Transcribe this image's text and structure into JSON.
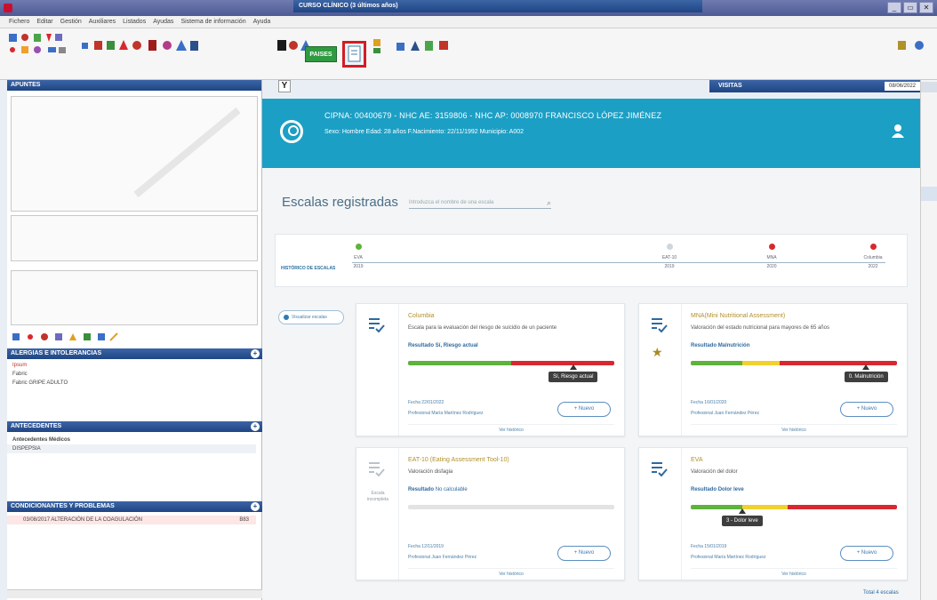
{
  "window": {
    "title": "",
    "controls": [
      "_",
      "▭",
      "✕"
    ]
  },
  "menu": [
    "Fichero",
    "Editar",
    "Gestión",
    "Auxiliares",
    "Listados",
    "Ayudas",
    "Sistema de información",
    "Ayuda"
  ],
  "toolbar": {
    "paises_label": "PAISES"
  },
  "left": {
    "apuntes_header": "APUNTES",
    "alergias_header": "ALERGIAS E INTOLERANCIAS",
    "alergias_rows": [
      "Ipsum",
      "Fabric",
      "Fabric   GRIPE ADULTO"
    ],
    "antecedentes_header": "ANTECEDENTES",
    "antecedentes_sub": "Antecedentes Médicos",
    "antecedentes_item": "DISPEPSIA",
    "condicionantes_header": "CONDICIONANTES Y PROBLEMAS",
    "condicionantes_item": "03/08/2017 ALTERACIÓN DE LA COAGULACIÓN",
    "condicionantes_code": "B83"
  },
  "center": {
    "header": "CURSO CLÍNICO (3 últimos años)",
    "visitas": "VISITAS",
    "visitas_date": "08/06/2022",
    "patient": {
      "line1": "CIPNA: 00400679   -   NHC AE: 3159806   -   NHC AP: 0008970      FRANCISCO LÓPEZ JIMÉNEZ",
      "line2": "Sexo: Hombre  Edad: 28 años  F.Nacimiento: 22/11/1992  Municipio: A002"
    },
    "escalas_title": "Escalas registradas",
    "search_placeholder": "Introduzca el nombre de una escala",
    "timeline": {
      "label": "HISTÓRICO DE ESCALAS",
      "points": [
        {
          "name": "EVA",
          "date": "2019",
          "color": "#5fb23c"
        },
        {
          "name": "EAT-10",
          "date": "2019",
          "color": "#cfd6dc"
        },
        {
          "name": "MNA",
          "date": "2020",
          "color": "#d8282e"
        },
        {
          "name": "Columbia",
          "date": "2022",
          "color": "#d8282e"
        }
      ]
    },
    "filter_label": "Visualizar escalas",
    "cards": [
      {
        "title": "Columbia",
        "desc": "Escala para la evaluación del riesgo de suicidio de un paciente",
        "result_label": "Resultado",
        "result": "Sí, Riesgo actual",
        "tip": "Sí, Riesgo actual",
        "date": "Fecha 22/01/2022",
        "prof": "Profesional María Martínez Rodríguez",
        "nuevo": "+  Nuevo",
        "vermas": "Ver histórico",
        "level": 0.8
      },
      {
        "title": "MNA(Mini Nutritional Assessment)",
        "desc": "Valoración del estado nutricional para mayores de 65 años",
        "result_label": "Resultado",
        "result": "Malnutrición",
        "tip": "0. Malnutrición",
        "date": "Fecha 16/01/2020",
        "prof": "Profesional Juan Fernández Pérez",
        "nuevo": "+  Nuevo",
        "vermas": "Ver histórico",
        "level": 0.85
      },
      {
        "title": "EAT-10 (Eating Assessment Tool-10)",
        "desc": "Valoración disfagia",
        "result_label": "Resultado",
        "result": "No calculable",
        "tip": "",
        "date": "Fecha 12/11/2019",
        "prof": "Profesional Juan Fernández Pérez",
        "nuevo": "+  Nuevo",
        "vermas": "Ver histórico",
        "no_eval": "Escala incompleta",
        "level": 0
      },
      {
        "title": "EVA",
        "desc": "Valoración del dolor",
        "result_label": "Resultado",
        "result": "Dolor leve",
        "tip": "3 - Dolor leve",
        "date": "Fecha 15/01/2019",
        "prof": "Profesional María Martínez Rodríguez",
        "nuevo": "+  Nuevo",
        "vermas": "Ver histórico",
        "level": 0.25
      }
    ],
    "footnote": "Total 4 escalas"
  },
  "colors": {
    "teal": "#1c9fc5",
    "navy": "#1f4583",
    "red": "#d8282e",
    "green": "#5fb23c",
    "yellow": "#f0d12d"
  }
}
